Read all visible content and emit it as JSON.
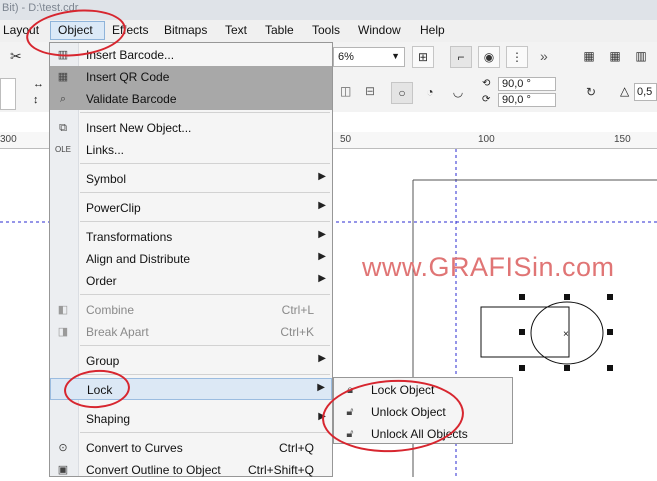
{
  "title_bar": {
    "text": "Bit) - D:\\test.cdr"
  },
  "menubar": {
    "items": [
      "Layout",
      "Object",
      "Effects",
      "Bitmaps",
      "Text",
      "Table",
      "Tools",
      "Window",
      "Help"
    ],
    "active": "Object"
  },
  "toolbar": {
    "zoom_value": "6%",
    "rotate_a": "90,0 °",
    "rotate_b": "90,0 °",
    "outline_value": "0,5"
  },
  "ruler": {
    "ticks": [
      "300",
      "50",
      "100",
      "150"
    ]
  },
  "object_menu": {
    "items": [
      {
        "label": "Insert Barcode...",
        "shortcut": "",
        "submenu": false,
        "icon": "barcode-icon"
      },
      {
        "label": "Insert QR Code",
        "shortcut": "",
        "submenu": false,
        "icon": "qr-code-icon"
      },
      {
        "label": "Validate Barcode",
        "shortcut": "",
        "submenu": false,
        "icon": "magnifier-icon"
      },
      {
        "label": "Insert New Object...",
        "shortcut": "",
        "submenu": false,
        "icon": "insert-object-icon"
      },
      {
        "label": "Links...",
        "shortcut": "",
        "submenu": false,
        "icon": "ole-icon"
      },
      {
        "label": "Symbol",
        "shortcut": "",
        "submenu": true
      },
      {
        "label": "PowerClip",
        "shortcut": "",
        "submenu": true
      },
      {
        "label": "Transformations",
        "shortcut": "",
        "submenu": true
      },
      {
        "label": "Align and Distribute",
        "shortcut": "",
        "submenu": true
      },
      {
        "label": "Order",
        "shortcut": "",
        "submenu": true
      },
      {
        "label": "Combine",
        "shortcut": "Ctrl+L",
        "submenu": false,
        "icon": "combine-icon"
      },
      {
        "label": "Break Apart",
        "shortcut": "Ctrl+K",
        "submenu": false,
        "icon": "break-apart-icon"
      },
      {
        "label": "Group",
        "shortcut": "",
        "submenu": true
      },
      {
        "label": "Lock",
        "shortcut": "",
        "submenu": true
      },
      {
        "label": "Shaping",
        "shortcut": "",
        "submenu": true
      },
      {
        "label": "Convert to Curves",
        "shortcut": "Ctrl+Q",
        "submenu": false,
        "icon": "convert-curves-icon"
      },
      {
        "label": "Convert Outline to Object",
        "shortcut": "Ctrl+Shift+Q",
        "submenu": false,
        "icon": "convert-outline-icon"
      }
    ]
  },
  "lock_submenu": {
    "items": [
      {
        "label": "Lock Object",
        "icon": "lock-icon"
      },
      {
        "label": "Unlock Object",
        "icon": "unlock-icon"
      },
      {
        "label": "Unlock All Objects",
        "icon": "unlock-all-icon"
      }
    ]
  },
  "watermark": "www.GRAFISin.com",
  "colors": {
    "highlight": "#a8a8a8",
    "selected": "#dce8f5",
    "annotation": "#d7262f",
    "watermark": "#e07575",
    "guide": "#2b2bd0"
  }
}
